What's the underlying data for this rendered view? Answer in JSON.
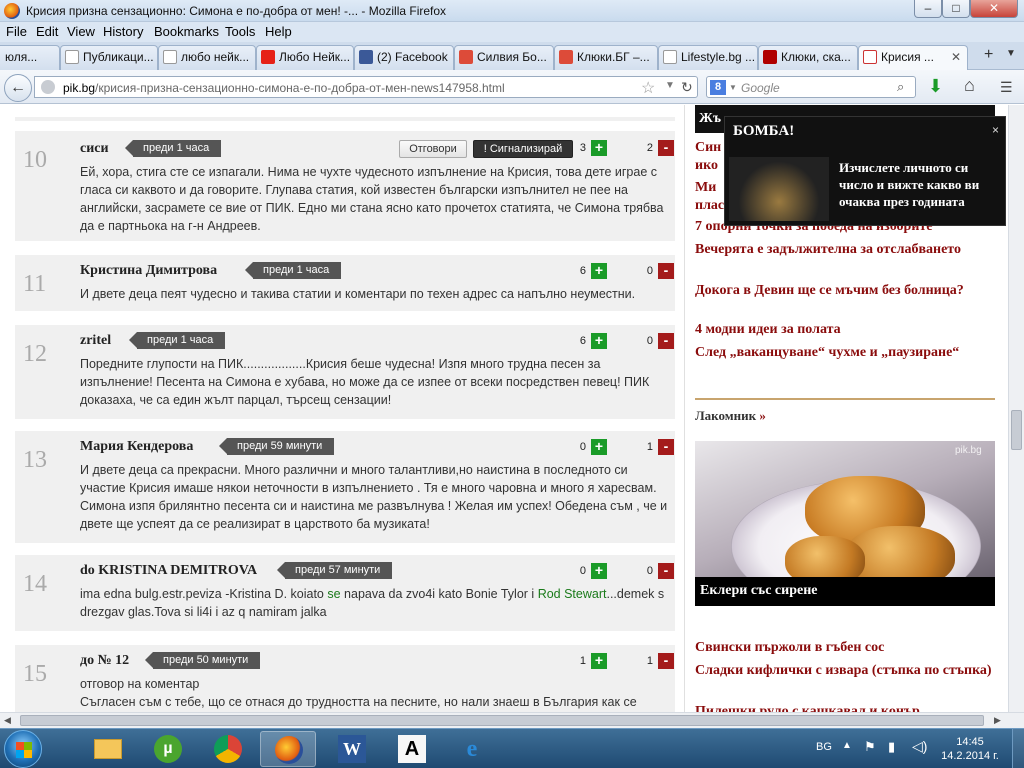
{
  "window": {
    "title": "Крисия призна сензационно: Симона е по-добра от мен! -... - Mozilla Firefox",
    "minimize": "–",
    "maximize": "□",
    "close": "✕"
  },
  "menu": [
    "File",
    "Edit",
    "View",
    "History",
    "Bookmarks",
    "Tools",
    "Help"
  ],
  "tabs": [
    {
      "label": "юля...",
      "icon": "page-icon",
      "color": "#cccccc"
    },
    {
      "label": "Публикаци...",
      "icon": "page-icon",
      "color": "#ffffff"
    },
    {
      "label": "любо нейк...",
      "icon": "page-icon",
      "color": "#ffffff"
    },
    {
      "label": "Любо Нейк...",
      "icon": "youtube-icon",
      "color": "#e62117"
    },
    {
      "label": "(2) Facebook",
      "icon": "facebook-icon",
      "color": "#3b5998"
    },
    {
      "label": "Силвия Бо...",
      "icon": "google-plus-icon",
      "color": "#dd4b39"
    },
    {
      "label": "Клюки.БГ –...",
      "icon": "google-plus-icon",
      "color": "#dd4b39"
    },
    {
      "label": "Lifestyle.bg ...",
      "icon": "page-icon",
      "color": "#ffffff"
    },
    {
      "label": "Клюки, ска...",
      "icon": "news-icon",
      "color": "#b00000"
    },
    {
      "label": "Крисия ...",
      "icon": "pik-icon",
      "color": "#ffffff"
    }
  ],
  "url": {
    "domain": "pik.bg",
    "path": "/крисия-призна-сензационно-симона-е-по-добра-от-мен-news147958.html"
  },
  "search": {
    "placeholder": "Google",
    "engine": "8"
  },
  "comments": [
    {
      "num": "10",
      "author": "сиси",
      "time": "преди 1 часа",
      "up": "3",
      "down": "2",
      "reply": "Отговори",
      "report": "Сигнализирай",
      "text": "Ей, хора, стига сте се изпагали. Нима не чухте чудесното изпълнение на Крисия, това дете играе с гласа си каквото и да говорите. Глупава статия, кой известен български изпълнител не пее на английски, засрамете се вие от ПИК. Едно ми стана ясно като прочетох статията, че Симона трябва да е партньока на г-н Андреев."
    },
    {
      "num": "11",
      "author": "Кристина Димитрова",
      "time": "преди 1 часа",
      "up": "6",
      "down": "0",
      "text": "И двете деца пеят чудесно и такива статии и коментари по техен адрес са напълно неуместни."
    },
    {
      "num": "12",
      "author": "zritel",
      "time": "преди 1 часа",
      "up": "6",
      "down": "0",
      "text": "Поредните глупости на ПИК..................Крисия беше чудесна! Изпя много трудна песен за изпълнение! Песента на Симона е хубава, но може да се изпее от всеки посредствен певец! ПИК доказаха, че са един жълт парцал, търсещ сензации!"
    },
    {
      "num": "13",
      "author": "Мария Кендерова",
      "time": "преди 59 минути",
      "up": "0",
      "down": "1",
      "text": "И двете деца са прекрасни. Много различни и много талантливи,но наистина в последното си участие Крисия имаше някои неточности в изпълнението . Тя е много чаровна и много я харесвам. Симона изпя брилянтно песента си и наистина ме развълнува ! Желая им успех! Обедена съм , че и двете ще успеят да се реализират в царството ба музиката!"
    },
    {
      "num": "14",
      "author": "do KRISTINA DEMITROVA",
      "time": "преди 57 минути",
      "up": "0",
      "down": "0",
      "text_a": "ima edna bulg.estr.peviza -Kristina D. koiato ",
      "link1": "se",
      "text_b": " napava da zvo4i kato Bonie Tylor i ",
      "link2": "Rod Stewart",
      "text_c": "...demek s drezgav glas.Tova si li4i i az q namiram jalka"
    },
    {
      "num": "15",
      "author": "до № 12",
      "time": "преди 50 минути",
      "up": "1",
      "down": "1",
      "text_a": "отговор на ",
      "link1": "коментар",
      "text_b": "Съгласен съм с тебе, що се отнася до трудността на песните, но нали знаеш в България как се"
    }
  ],
  "sidebar": {
    "top_links": [
      "Син",
      "ико",
      "Ми",
      "плас",
      "7 опорни точки за победа на изборите",
      "Вечерята е задължителна за отслабването",
      "Докога в Девин ще се мъчим без болница?",
      "4 модни идеи за полата",
      "След „ваканцуване“ чухме и „паузиране“"
    ],
    "section_prefix": "Жъ",
    "section": "Лакомник",
    "section_arrow": "»",
    "featured_caption": "Еклери със сирене",
    "watermark": "pik.bg",
    "links": [
      "Свински пържоли в гъбен сос",
      "Сладки кифлички с извара (стъпка по стъпка)",
      "Пилешки руло с кашкавал и конър"
    ]
  },
  "popup": {
    "title": "БОМБА!",
    "close": "×",
    "text": "Изчислете личното си число и вижте какво ви очаква през годината"
  },
  "taskbar": {
    "lang": "BG",
    "time": "14:45",
    "date": "14.2.2014 г."
  }
}
